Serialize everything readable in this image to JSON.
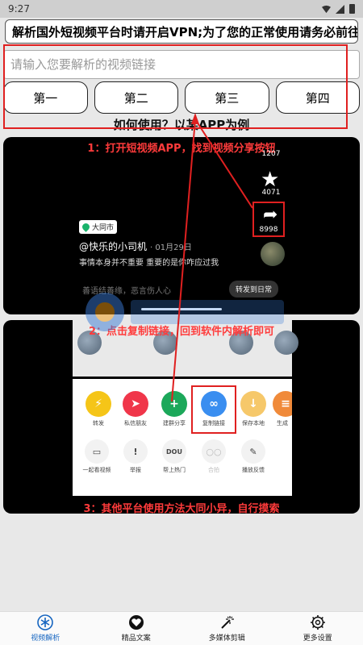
{
  "status": {
    "time": "9:27"
  },
  "banner": {
    "text": "解析国外短视频平台时请开启VPN;为了您的正常使用请务必前往"
  },
  "search": {
    "placeholder": "请输入您要解析的视频链接"
  },
  "buttons": [
    "第一",
    "第二",
    "第三",
    "第四"
  ],
  "howto": "如何使用？以某APP为例",
  "card1": {
    "caption": "1：打开短视频APP，找到视频分享按钮",
    "star_count": "4071",
    "share_count": "8998",
    "top_count": "1207",
    "location": "大同市",
    "user": "@快乐的小司机",
    "date": "· 01月29日",
    "desc": "事情本身并不重要 重要的是你咋应过我",
    "quote": "善语结善缘，恶言伤人心",
    "forward": "转发到日常"
  },
  "card2": {
    "caption": "2：点击复制链接，回到软件内解析即可",
    "share_items": [
      {
        "label": "转发",
        "color": "#f5c518",
        "glyph": "⚡"
      },
      {
        "label": "私信朋友",
        "color": "#f0364a",
        "glyph": "➤"
      },
      {
        "label": "建群分享",
        "color": "#1ca85a",
        "glyph": "+"
      },
      {
        "label": "复制链接",
        "color": "#3a8ef0",
        "glyph": "∞"
      },
      {
        "label": "保存本地",
        "color": "#f6c86a",
        "glyph": "↓"
      },
      {
        "label": "生成",
        "color": "#f08a3a",
        "glyph": "≡"
      }
    ],
    "tools": [
      {
        "label": "一起看视频",
        "glyph": "▭"
      },
      {
        "label": "举报",
        "glyph": "!"
      },
      {
        "label": "帮上热门",
        "glyph": "DOU"
      },
      {
        "label": "合拍",
        "glyph": "○○"
      },
      {
        "label": "播放反馈",
        "glyph": "✎"
      }
    ]
  },
  "card3": {
    "caption": "3：其他平台使用方法大同小异，自行摸索"
  },
  "nav": [
    {
      "label": "视频解析",
      "icon": "asterisk-icon",
      "active": true
    },
    {
      "label": "精品文案",
      "icon": "heart-icon",
      "active": false
    },
    {
      "label": "多媒体剪辑",
      "icon": "magic-wand-icon",
      "active": false
    },
    {
      "label": "更多设置",
      "icon": "gear-icon",
      "active": false
    }
  ],
  "colors": {
    "accent": "#1565c0",
    "highlight": "#e02020",
    "caption": "#ff3b3b"
  }
}
